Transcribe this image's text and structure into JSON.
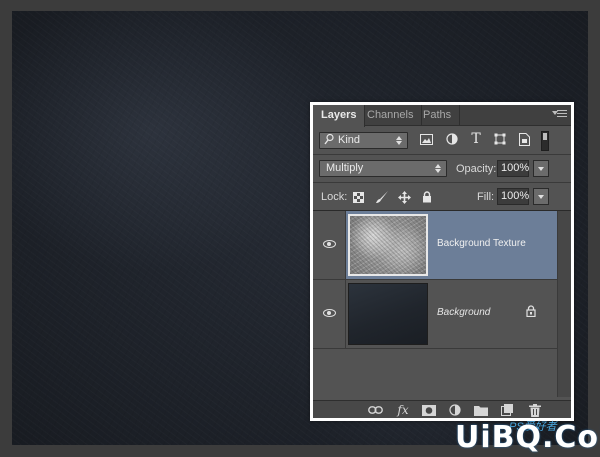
{
  "panel": {
    "tabs": [
      {
        "label": "Layers",
        "active": true
      },
      {
        "label": "Channels",
        "active": false
      },
      {
        "label": "Paths",
        "active": false
      }
    ],
    "filter": {
      "label": "Kind",
      "icons": [
        "image-filter-icon",
        "adjustment-filter-icon",
        "type-filter-icon",
        "shape-filter-icon",
        "smart-object-filter-icon"
      ]
    },
    "blend": {
      "mode": "Multiply",
      "opacity_label": "Opacity:",
      "opacity_value": "100%"
    },
    "lock": {
      "label": "Lock:",
      "fill_label": "Fill:",
      "fill_value": "100%"
    },
    "layers": [
      {
        "name": "Background Texture",
        "visible": true,
        "selected": true,
        "locked": false
      },
      {
        "name": "Background",
        "visible": true,
        "selected": false,
        "locked": true
      }
    ],
    "toolbar_icons": [
      "link-icon",
      "fx-icon",
      "mask-icon",
      "adjustment-icon",
      "folder-icon",
      "new-layer-icon",
      "trash-icon"
    ],
    "toolbar_fx_label": "fx"
  },
  "colors": {
    "selected_layer": "#6c7e98",
    "panel_bg": "#535353",
    "panel_border": "#ffffff"
  },
  "watermark": {
    "text": "UiBQ.CoM",
    "small_text": "PS爱好者"
  }
}
